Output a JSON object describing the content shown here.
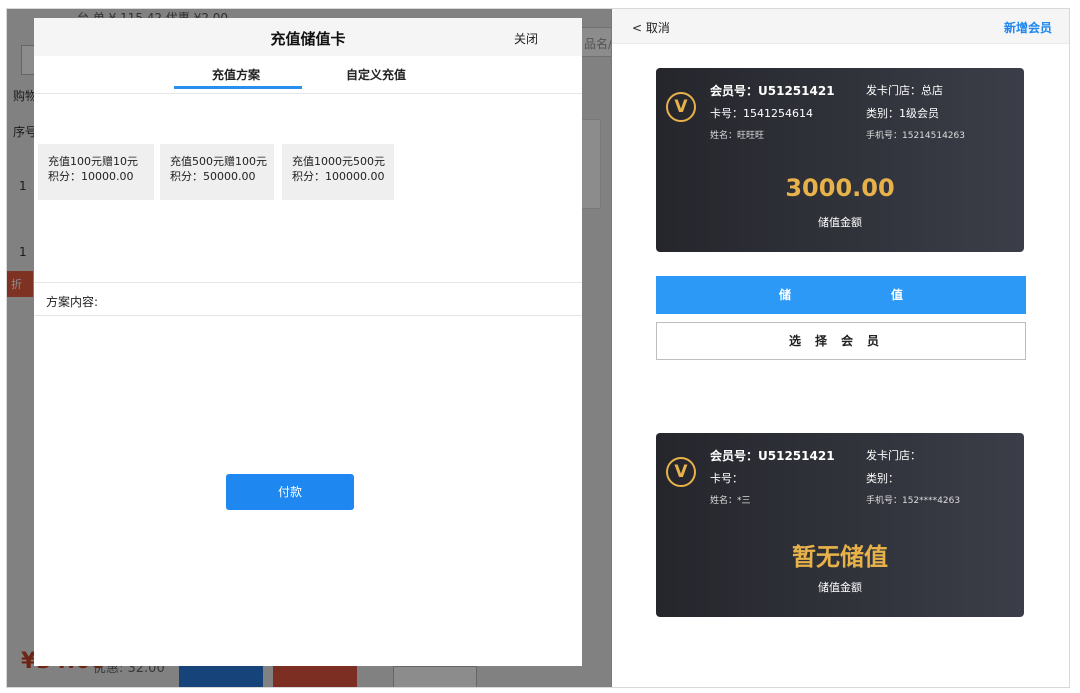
{
  "background_app": {
    "top_text": "台  单 ¥ 115.42  优惠 ¥2.00",
    "search_placeholder": "品名/",
    "cart_label": "购物",
    "seq_label": "序号",
    "row1_index": "1",
    "row2_index": "1",
    "discount_tag": "折",
    "total": "¥34.00",
    "discount": "优惠: 32.00"
  },
  "modal": {
    "title": "充值储值卡",
    "close_label": "关闭",
    "tabs": [
      {
        "label": "充值方案",
        "active": true
      },
      {
        "label": "自定义充值",
        "active": false
      }
    ],
    "plans": [
      {
        "name": "充值100元赠10元",
        "points": "积分：10000.00"
      },
      {
        "name": "充值500元赠100元",
        "points": "积分：50000.00"
      },
      {
        "name": "充值1000元500元",
        "points": "积分：100000.00"
      }
    ],
    "content_label": "方案内容:",
    "pay_label": "付款"
  },
  "right_panel": {
    "cancel_label": "< 取消",
    "add_member_label": "新增会员",
    "card_1": {
      "logo": "V",
      "member_no": "会员号：U51251421",
      "store": "发卡门店：总店",
      "card_no": "卡号：1541254614",
      "level": "类别：1级会员",
      "name": "姓名：旺旺旺",
      "phone": "手机号：15214514263",
      "amount": "3000.00",
      "amount_label": "储值金额"
    },
    "store_button": {
      "char1": "储",
      "char2": "值"
    },
    "select_member_label": "选择会员",
    "card_2": {
      "logo": "V",
      "member_no": "会员号：U51251421",
      "store": "发卡门店：",
      "card_no": "卡号：",
      "level": "类别：",
      "name": "姓名：*三",
      "phone": "手机号：152****4263",
      "amount": "暂无储值",
      "amount_label": "储值金额"
    }
  },
  "colors": {
    "primary_blue": "#1e87f0",
    "gold": "#e8b24a",
    "card_dark": "#25262c"
  }
}
